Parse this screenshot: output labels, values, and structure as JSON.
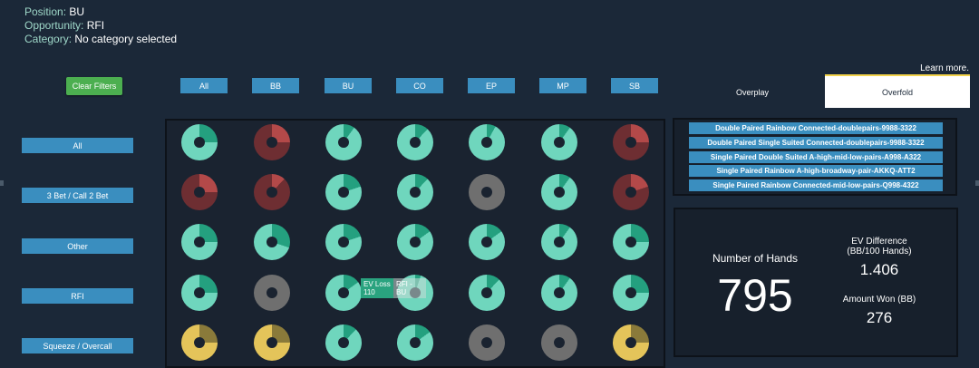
{
  "info": {
    "position_key": "Position:",
    "position_value": "BU",
    "opportunity_key": "Opportunity:",
    "opportunity_value": "RFI",
    "category_key": "Category:",
    "category_value": "No category selected"
  },
  "learn_more": "Learn more.",
  "clear_filters": "Clear Filters",
  "columns": [
    "All",
    "BB",
    "BU",
    "CO",
    "EP",
    "MP",
    "SB"
  ],
  "tabs": {
    "overplay": "Overplay",
    "overfold": "Overfold"
  },
  "rows": [
    "All",
    "3 Bet / Call 2 Bet",
    "Other",
    "RFI",
    "Squeeze / Overcall"
  ],
  "colors": {
    "green_light": "#6fd6bd",
    "green_dark": "#24a07f",
    "red_light": "#b34949",
    "red_dark": "#6e2e32",
    "gray": "#6f6f6f",
    "yellow_light": "#e4c45a",
    "yellow_dark": "#8a7a3a",
    "accent_blue": "#3a8ebf",
    "clear_green": "#4caf50"
  },
  "grid": [
    [
      {
        "c": "green",
        "p": 0.25
      },
      {
        "c": "red",
        "p": 0.25
      },
      {
        "c": "green",
        "p": 0.1
      },
      {
        "c": "green",
        "p": 0.12
      },
      {
        "c": "green",
        "p": 0.08
      },
      {
        "c": "green",
        "p": 0.1
      },
      {
        "c": "red",
        "p": 0.25
      }
    ],
    [
      {
        "c": "red",
        "p": 0.25
      },
      {
        "c": "red",
        "p": 0.12
      },
      {
        "c": "green",
        "p": 0.2
      },
      {
        "c": "green",
        "p": 0.12
      },
      {
        "c": "gray",
        "p": 0
      },
      {
        "c": "green",
        "p": 0.1
      },
      {
        "c": "red",
        "p": 0.2
      }
    ],
    [
      {
        "c": "green",
        "p": 0.25
      },
      {
        "c": "green",
        "p": 0.3
      },
      {
        "c": "green",
        "p": 0.2
      },
      {
        "c": "green",
        "p": 0.15
      },
      {
        "c": "green",
        "p": 0.15
      },
      {
        "c": "green",
        "p": 0.1
      },
      {
        "c": "green",
        "p": 0.25
      }
    ],
    [
      {
        "c": "green",
        "p": 0.25
      },
      {
        "c": "gray",
        "p": 0
      },
      {
        "c": "green",
        "p": 0.15
      },
      {
        "c": "green",
        "p": 0.05
      },
      {
        "c": "green",
        "p": 0.12
      },
      {
        "c": "green",
        "p": 0.1
      },
      {
        "c": "green",
        "p": 0.25
      }
    ],
    [
      {
        "c": "yellow",
        "p": 0.25
      },
      {
        "c": "yellow",
        "p": 0.25
      },
      {
        "c": "green",
        "p": 0.12
      },
      {
        "c": "green",
        "p": 0.15
      },
      {
        "c": "gray",
        "p": 0
      },
      {
        "c": "gray",
        "p": 0
      },
      {
        "c": "yellow",
        "p": 0.25
      }
    ]
  ],
  "tooltip": {
    "label": "EV Loss",
    "value": "110",
    "title": "RFI - BU"
  },
  "categories_list": [
    "Double Paired Rainbow Connected-doublepairs-9988-3322",
    "Double Paired Single Suited Connected-doublepairs-9988-3322",
    "Single Paired Double Suited A-high-mid-low-pairs-A998-A322",
    "Single Paired Rainbow A-high-broadway-pair-AKKQ-ATT2",
    "Single Paired Rainbow Connected-mid-low-pairs-Q998-4322"
  ],
  "stats": {
    "hands_label": "Number of Hands",
    "hands_value": "795",
    "evdiff_label": "EV Difference",
    "evdiff_sub": "(BB/100 Hands)",
    "evdiff_value": "1.406",
    "won_label": "Amount Won (BB)",
    "won_value": "276"
  }
}
